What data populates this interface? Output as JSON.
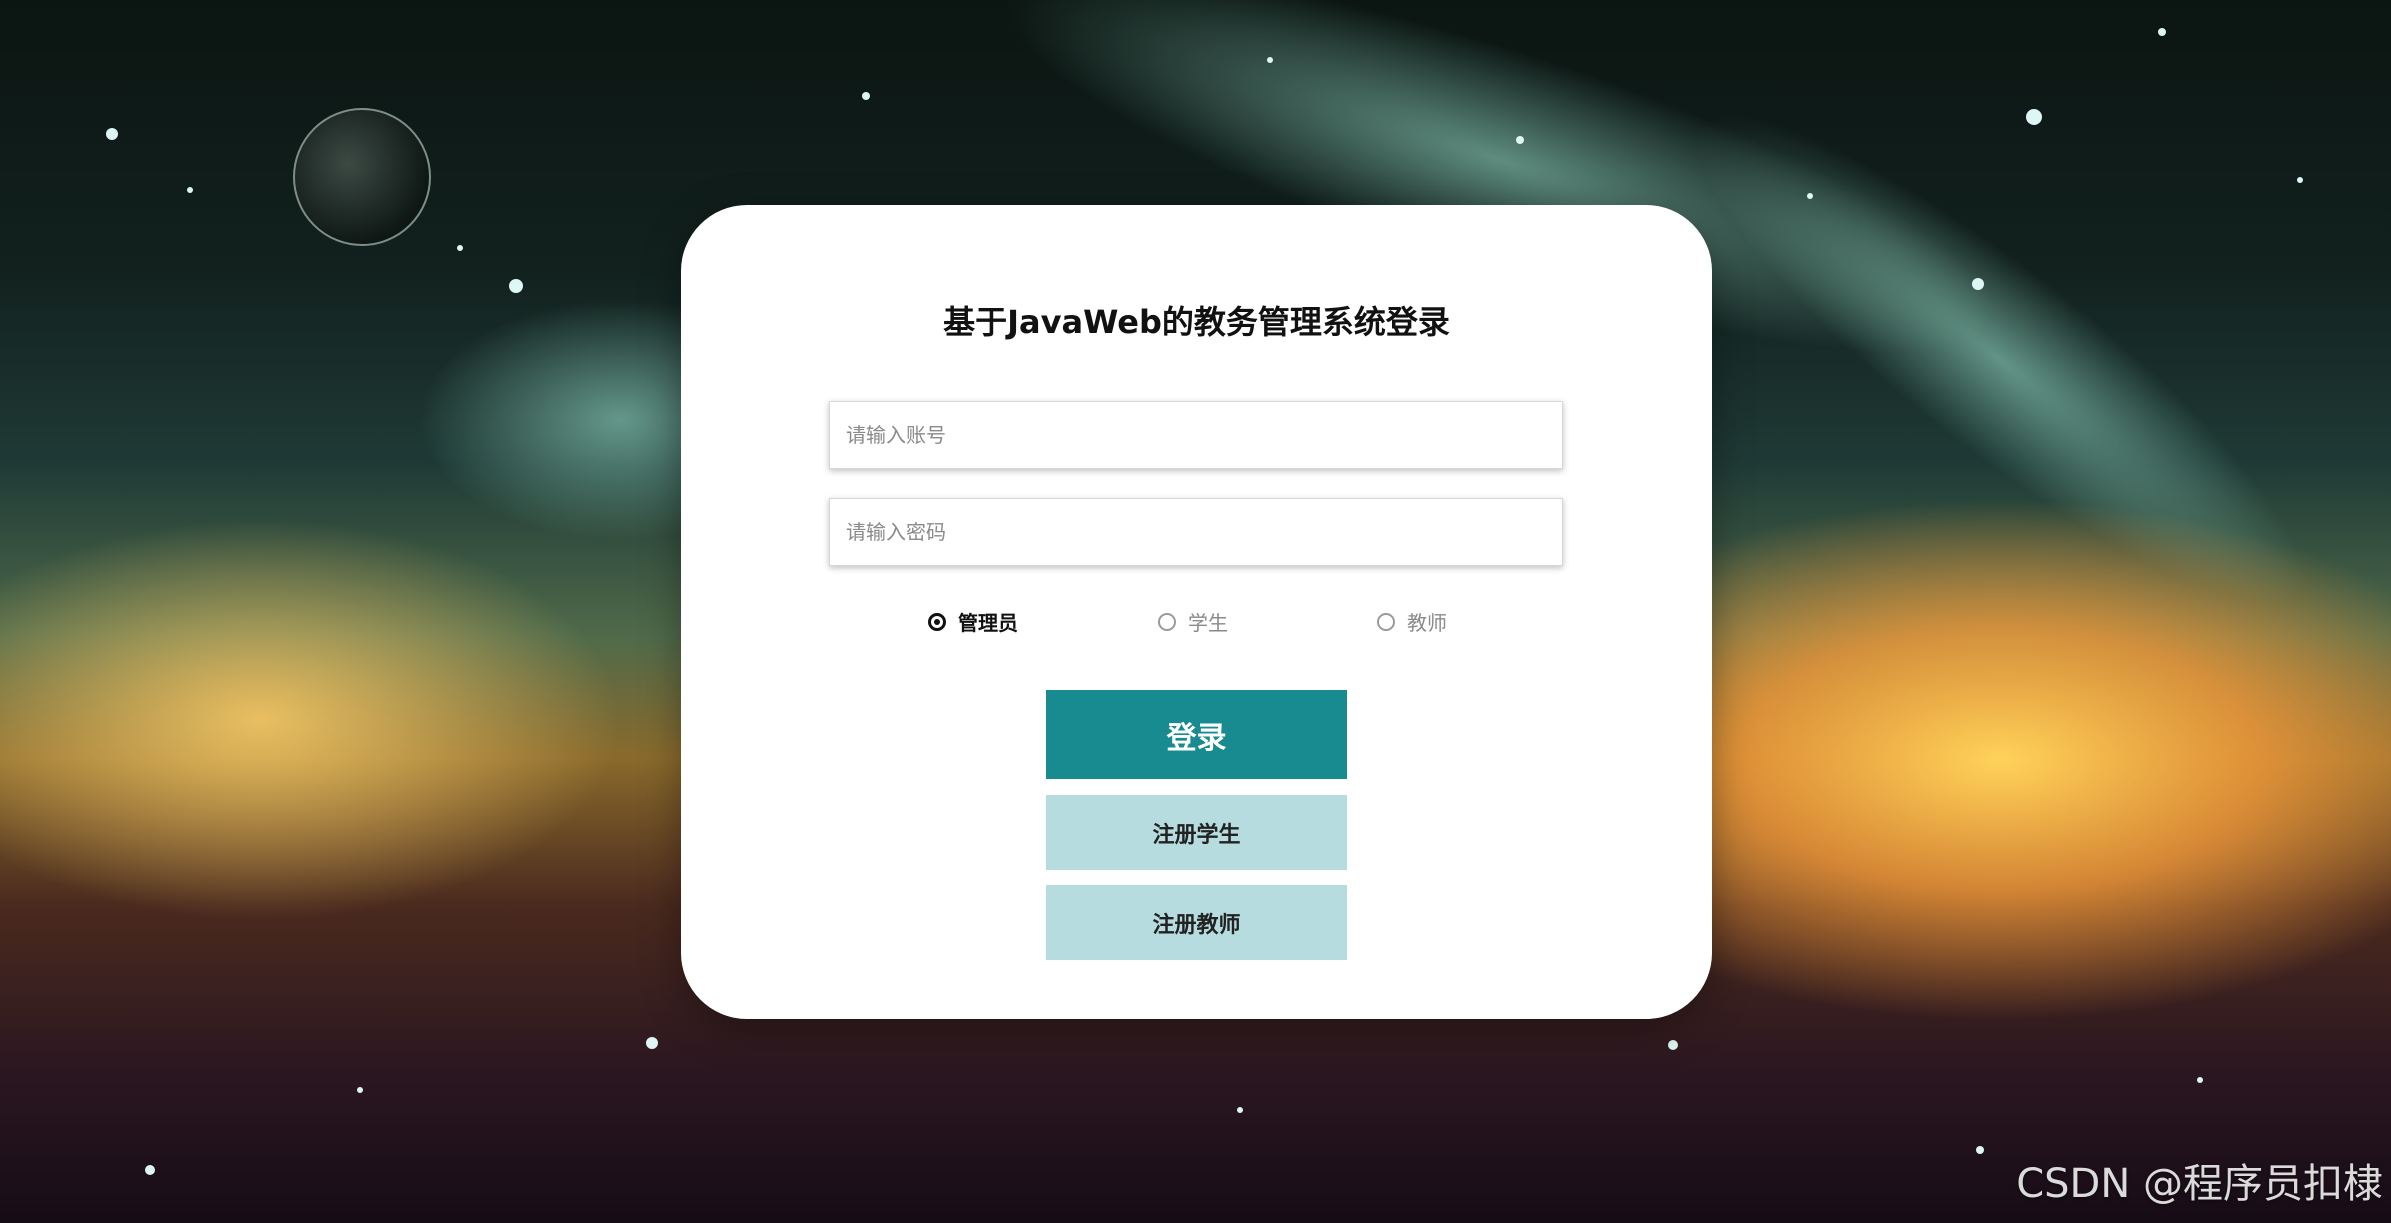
{
  "login": {
    "title": "基于JavaWeb的教务管理系统登录",
    "account_placeholder": "请输入账号",
    "password_placeholder": "请输入密码",
    "roles": [
      {
        "label": "管理员",
        "selected": true
      },
      {
        "label": "学生",
        "selected": false
      },
      {
        "label": "教师",
        "selected": false
      }
    ],
    "login_button": "登录",
    "register_student_button": "注册学生",
    "register_teacher_button": "注册教师"
  },
  "colors": {
    "primary": "#178b8f",
    "secondary": "#b6dcdf"
  },
  "watermark": "CSDN @程序员扣棣"
}
